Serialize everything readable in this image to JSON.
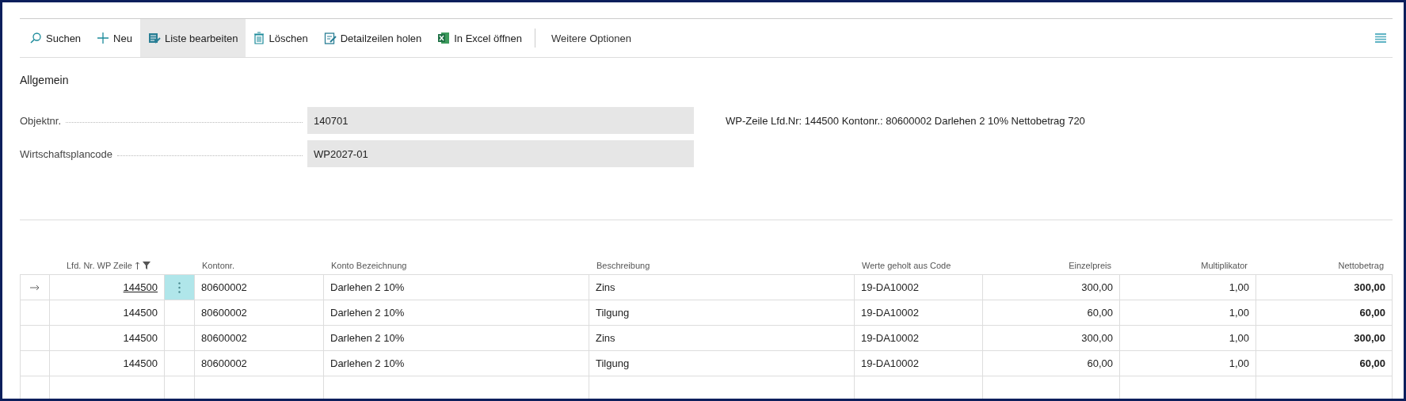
{
  "toolbar": {
    "actions": [
      {
        "label": "Suchen",
        "selected": false
      },
      {
        "label": "Neu",
        "selected": false
      },
      {
        "label": "Liste bearbeiten",
        "selected": true
      },
      {
        "label": "Löschen",
        "selected": false
      },
      {
        "label": "Detailzeilen holen",
        "selected": false
      },
      {
        "label": "In Excel öffnen",
        "selected": false
      }
    ],
    "more": "Weitere Optionen"
  },
  "section": {
    "title": "Allgemein",
    "fields": [
      {
        "label": "Objektnr.",
        "value": "140701"
      },
      {
        "label": "Wirtschaftsplancode",
        "value": "WP2027-01"
      }
    ],
    "info": "WP-Zeile Lfd.Nr: 144500  Kontonr.: 80600002 Darlehen 2 10%  Nettobetrag 720"
  },
  "table": {
    "columns": [
      "Lfd. Nr. WP Zeile",
      "Kontonr.",
      "Konto Bezeichnung",
      "Beschreibung",
      "Werte geholt aus Code",
      "Einzelpreis",
      "Multiplikator",
      "Nettobetrag"
    ],
    "rows": [
      {
        "selected": true,
        "cells": [
          "144500",
          "80600002",
          "Darlehen 2 10%",
          "Zins",
          "19-DA10002",
          "300,00",
          "1,00",
          "300,00"
        ]
      },
      {
        "selected": false,
        "cells": [
          "144500",
          "80600002",
          "Darlehen 2 10%",
          "Tilgung",
          "19-DA10002",
          "60,00",
          "1,00",
          "60,00"
        ]
      },
      {
        "selected": false,
        "cells": [
          "144500",
          "80600002",
          "Darlehen 2 10%",
          "Zins",
          "19-DA10002",
          "300,00",
          "1,00",
          "300,00"
        ]
      },
      {
        "selected": false,
        "cells": [
          "144500",
          "80600002",
          "Darlehen 2 10%",
          "Tilgung",
          "19-DA10002",
          "60,00",
          "1,00",
          "60,00"
        ]
      }
    ]
  }
}
